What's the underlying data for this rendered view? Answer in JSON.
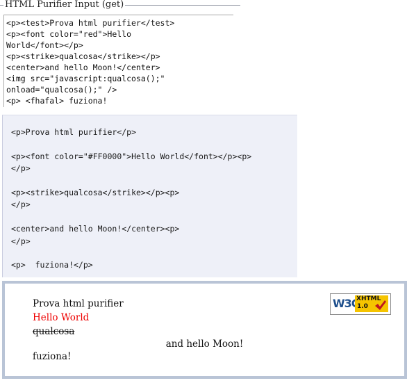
{
  "form": {
    "legend": "HTML Purifier Input (get)",
    "input_value": "<p><test>Prova html purifier</test>\n<p><font color=\"red\">Hello\nWorld</font></p>\n<p><strike>qualcosa</strike></p>\n<center>and hello Moon!</center>\n<img src=\"javascript:qualcosa();\"\nonload=\"qualcosa();\" />\n<p> <fhafal> fuziona!"
  },
  "output": {
    "purified_code": "<p>Prova html purifier</p>\n\n<p><font color=\"#FF0000\">Hello World</font></p><p>\n</p>\n\n<p><strike>qualcosa</strike></p><p>\n</p>\n\n<center>and hello Moon!</center><p>\n</p>\n\n<p>  fuziona!</p>"
  },
  "preview": {
    "line1": "Prova html purifier",
    "line2": "Hello World",
    "line2_color": "#EE0000",
    "line3": "qualcosa",
    "line4": "and hello Moon!",
    "line5": "fuziona!"
  },
  "badge": {
    "left_text": "W3C",
    "spec_name": "XHTML",
    "spec_version": "1.0",
    "icon": "checkmark-icon",
    "spec_color": "#F5C400",
    "logo_color": "#1E4F8C",
    "check_color": "#C0161E"
  }
}
